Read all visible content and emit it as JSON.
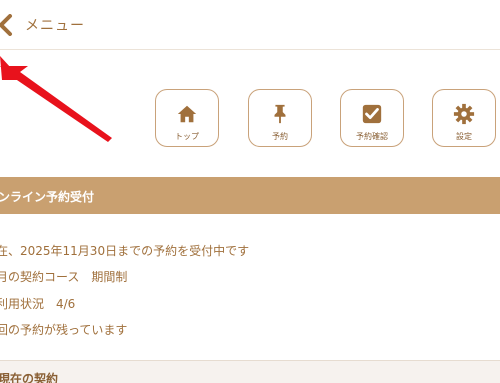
{
  "header": {
    "title": "メニュー",
    "back_icon": "chevron-left-icon"
  },
  "nav": {
    "tiles": [
      {
        "label": "トップ",
        "icon": "home-icon"
      },
      {
        "label": "予約",
        "icon": "pin-icon"
      },
      {
        "label": "予約確認",
        "icon": "check-square-icon"
      },
      {
        "label": "設定",
        "icon": "gear-icon"
      }
    ]
  },
  "online_booking": {
    "title": "ンライン予約受付",
    "lines": [
      "在、2025年11月30日までの予約を受付中です",
      "月の契約コース　期間制",
      "利用状況　4/6",
      "回の予約が残っています"
    ]
  },
  "current_contract": {
    "title": "現在の契約"
  },
  "colors": {
    "brand": "#c9a070",
    "text": "#a0703c",
    "arrow": "#e8121c"
  }
}
